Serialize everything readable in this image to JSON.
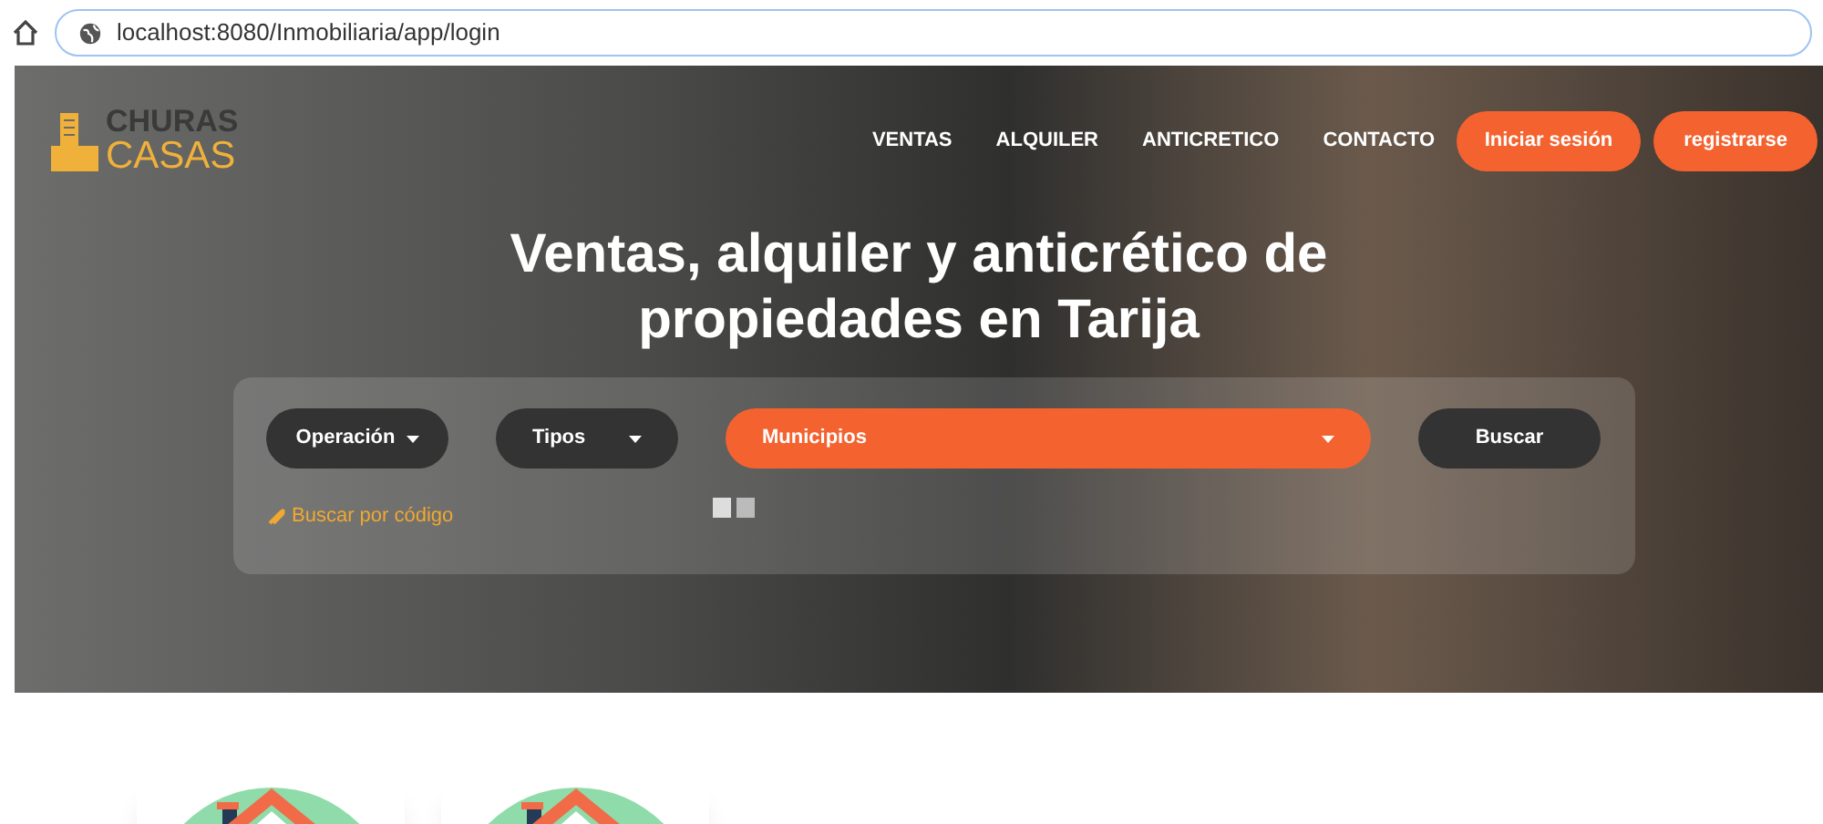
{
  "browser": {
    "url": "localhost:8080/Inmobiliaria/app/login"
  },
  "logo": {
    "line1": "CHURAS",
    "line2": "CASAS"
  },
  "nav": {
    "links": [
      "VENTAS",
      "ALQUILER",
      "ANTICRETICO",
      "CONTACTO"
    ],
    "buttons": [
      "Iniciar sesión",
      "registrarse"
    ]
  },
  "hero": {
    "title": "Ventas, alquiler y anticrético de propiedades en Tarija"
  },
  "search": {
    "dropdowns": [
      {
        "kind": "dark",
        "label": "Operación"
      },
      {
        "kind": "dark",
        "label": "Tipos"
      },
      {
        "kind": "accent",
        "label": "Municipios"
      }
    ],
    "button": "Buscar",
    "code_link": "Buscar por código"
  }
}
